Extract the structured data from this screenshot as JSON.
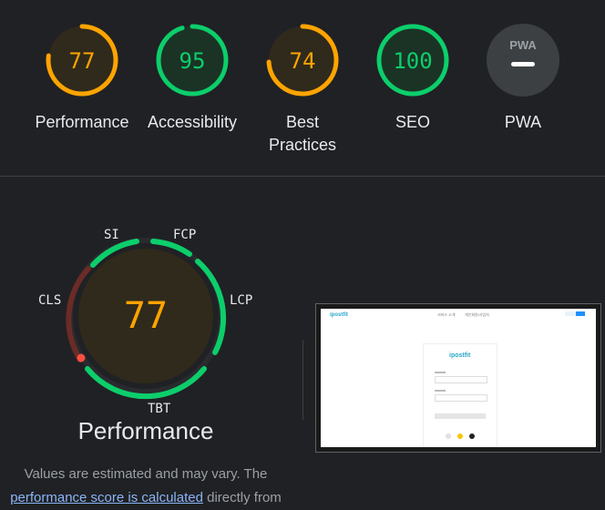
{
  "categories": [
    {
      "name": "Performance",
      "score": "77",
      "value": 77,
      "color": "#ffa400",
      "bg": "#302a1c"
    },
    {
      "name": "Accessibility",
      "score": "95",
      "value": 95,
      "color": "#0cce6b",
      "bg": "#1b3325"
    },
    {
      "name": "Best Practices",
      "score": "74",
      "value": 74,
      "color": "#ffa400",
      "bg": "#302a1c"
    },
    {
      "name": "SEO",
      "score": "100",
      "value": 100,
      "color": "#0cce6b",
      "bg": "#1b3325"
    },
    {
      "name": "PWA",
      "badge": "PWA",
      "color": "#9aa0a6",
      "bg": "#3c4043"
    }
  ],
  "performance": {
    "score": "77",
    "title": "Performance",
    "metrics": {
      "si": "SI",
      "fcp": "FCP",
      "lcp": "LCP",
      "tbt": "TBT",
      "cls": "CLS"
    },
    "note_text_1": "Values are estimated and may vary. The",
    "note_link": "performance score is calculated",
    "note_text_2": "directly from"
  },
  "screenshot": {
    "logo": "ipostfit",
    "nav_1": "서비스 소개",
    "nav_2": "개인회원/사업자"
  },
  "colors": {
    "pass": "#0cce6b",
    "average": "#ffa400",
    "fail": "#ff4e42",
    "fail_dark": "#6b2b26"
  }
}
